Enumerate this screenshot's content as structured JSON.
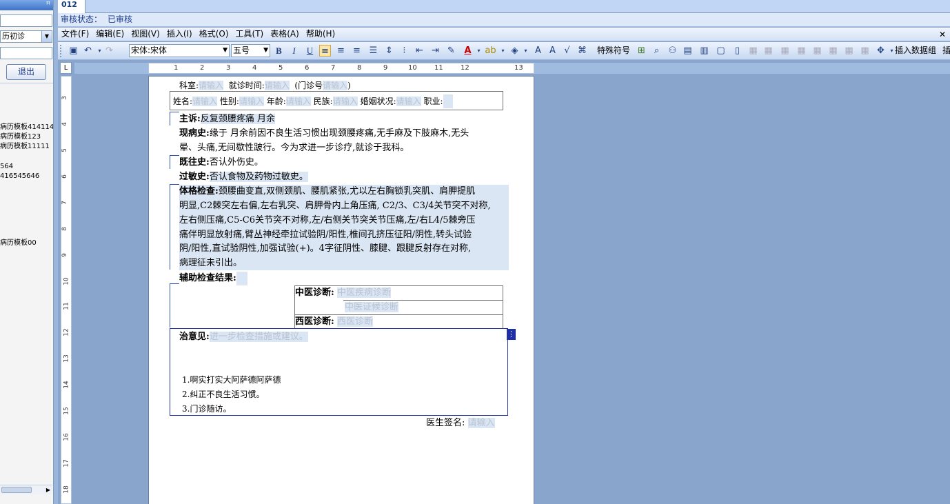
{
  "left_panel": {
    "input2": "历初诊",
    "exit_label": "退出",
    "tree_items": [
      "病历模板414114",
      "病历模板123",
      "病历模板11111",
      "564",
      "416545646",
      "病历模板00"
    ]
  },
  "tab": {
    "label": "012"
  },
  "status": {
    "label": "审核状态：",
    "value": "已审核"
  },
  "menu": {
    "items": [
      "文件(F)",
      "编辑(E)",
      "视图(V)",
      "插入(I)",
      "格式(O)",
      "工具(T)",
      "表格(A)",
      "帮助(H)"
    ],
    "close": "✕"
  },
  "toolbar": {
    "font_name": "宋体:宋体",
    "font_size": "五号",
    "special_symbol": "特殊符号",
    "insert_group": "插入数据组",
    "insert_short": "插"
  },
  "ruler": {
    "corner": "L",
    "ticks": [
      "1",
      "2",
      "3",
      "4",
      "5",
      "6",
      "7",
      "8",
      "9",
      "10",
      "11",
      "12",
      "13"
    ],
    "vticks": [
      "3",
      "4",
      "5",
      "6",
      "7",
      "8",
      "9",
      "10",
      "11",
      "12",
      "13",
      "14",
      "15",
      "16",
      "17",
      "18"
    ]
  },
  "doc": {
    "dept_label": "科室:",
    "ph_input": "请输入",
    "visit_label": "就诊时间:",
    "outpatient_label": "(门诊号",
    "outpatient_close": ")",
    "name_label": "姓名:",
    "sex_label": "性别:",
    "age_label": "年龄:",
    "ethnic_label": "民族:",
    "marital_label": "婚姻状况:",
    "job_label": "职业:",
    "chief_label": "主诉:",
    "chief_text": "反复颈腰疼痛 月余",
    "hpi_label": "现病史:",
    "hpi_text1": "缘于 月余前因不良生活习惯出现颈腰疼痛,无手麻及下肢麻木,无头",
    "hpi_text2": "晕、头痛,无间歇性跛行。今为求进一步诊疗,就诊于我科。",
    "past_label": "既往史:",
    "past_text": "否认外伤史。",
    "allergy_label": "过敏史:",
    "allergy_text": "否认食物及药物过敏史。",
    "exam_label": "体格检查:",
    "exam_text1": "颈腰曲变直,双侧颈肌、腰肌紧张,尤以左右胸锁乳突肌、肩胛提肌",
    "exam_text2": "明显,C2棘突左右偏,左右乳突、肩胛骨内上角压痛, C2/3、C3/4关节突不对称,",
    "exam_text3": "左右侧压痛,C5-C6关节突不对称,左/右侧关节突关节压痛,左/右L4/5棘旁压",
    "exam_text4": "痛伴明显放射痛,臂丛神经牵拉试验阴/阳性,椎间孔挤压征阳/阴性,转头试验",
    "exam_text5": "阴/阳性,直试验阴性,加强试验(+)。4字征阴性、膝腱、跟腱反射存在对称,",
    "exam_text6": "病理征未引出。",
    "aux_label": "辅助检查结果:",
    "tcm_label": "中医诊断:",
    "tcm_ph1": "中医疾病诊断",
    "tcm_ph2": "中医证候诊断",
    "wm_label": "西医诊断:",
    "wm_ph": "西医诊断",
    "advice_label": "治意见:",
    "advice_ph": "进一步检查措施或建议。",
    "advice_items": [
      "1.啊实打实大阿萨德阿萨德",
      "2.纠正不良生活习惯。",
      "3.门诊随访。"
    ],
    "sign_label": "医生签名:",
    "sign_ph": "请输入"
  }
}
